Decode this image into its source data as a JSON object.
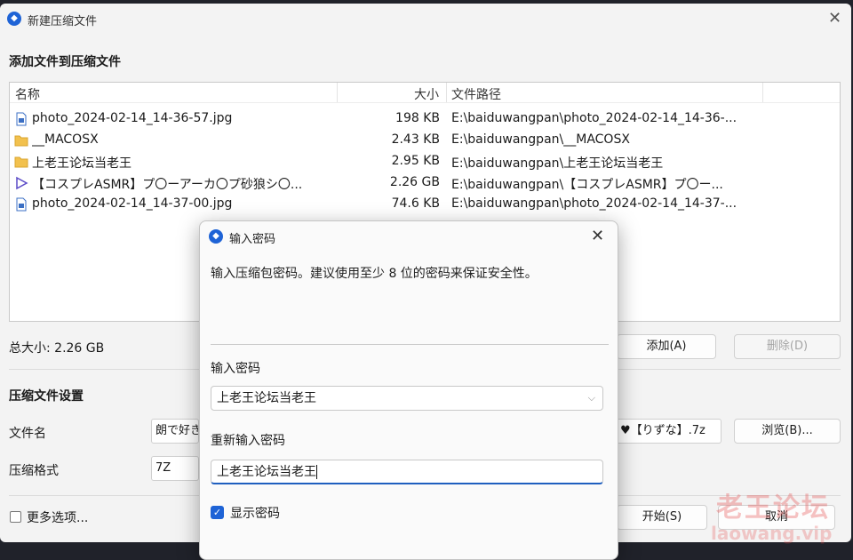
{
  "main": {
    "title": "新建压缩文件",
    "add_heading": "添加文件到压缩文件",
    "columns": {
      "name": "名称",
      "size": "大小",
      "path": "文件路径"
    },
    "files": [
      {
        "name": "photo_2024-02-14_14-36-57.jpg",
        "size": "198 KB",
        "path": "E:\\baiduwangpan\\photo_2024-02-14_14-36-...",
        "icon": "image-file-icon"
      },
      {
        "name": "__MACOSX",
        "size": "2.43 KB",
        "path": "E:\\baiduwangpan\\__MACOSX",
        "icon": "folder-icon"
      },
      {
        "name": "上老王论坛当老王",
        "size": "2.95 KB",
        "path": "E:\\baiduwangpan\\上老王论坛当老王",
        "icon": "folder-icon"
      },
      {
        "name": "【コスプレASMR】プ〇ーアーカ〇プ砂狼シ〇...",
        "size": "2.26 GB",
        "path": "E:\\baiduwangpan\\【コスプレASMR】プ〇ー...",
        "icon": "video-file-icon"
      },
      {
        "name": "photo_2024-02-14_14-37-00.jpg",
        "size": "74.6 KB",
        "path": "E:\\baiduwangpan\\photo_2024-02-14_14-37-...",
        "icon": "image-file-icon"
      }
    ],
    "total_size": "总大小: 2.26 GB",
    "add_button": "添加(A)",
    "delete_button": "删除(D)",
    "settings_heading": "压缩文件设置",
    "filename_label": "文件名",
    "filename_left": "朗で好き",
    "filename_right": "♥【りずな】.7z",
    "browse_button": "浏览(B)...",
    "format_label": "压缩格式",
    "format_value": "7Z",
    "more_options": "更多选项...",
    "start_button": "开始(S)",
    "cancel_button": "取消"
  },
  "dialog": {
    "title": "输入密码",
    "description": "输入压缩包密码。建议使用至少 8 位的密码来保证安全性。",
    "password_label": "输入密码",
    "password_value": "上老王论坛当老王",
    "reenter_label": "重新输入密码",
    "reenter_value": "上老王论坛当老王",
    "show_password": "显示密码"
  },
  "watermark": {
    "text": "老王论坛",
    "sub": "laowang.vip"
  },
  "colors": {
    "accent": "#1e63d6",
    "window_bg": "#f3f3f3"
  }
}
